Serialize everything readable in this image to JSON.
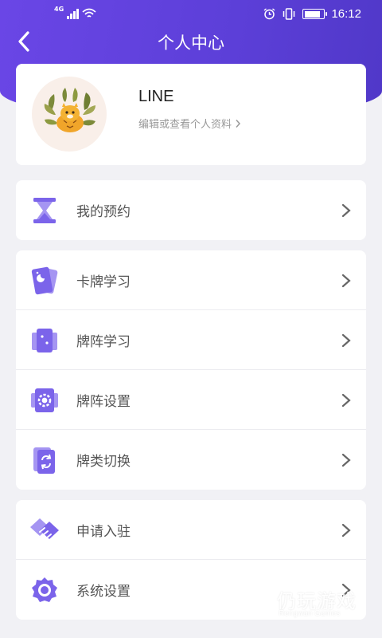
{
  "status_bar": {
    "network": "4G",
    "time": "16:12",
    "battery_level": 0.85,
    "icons": [
      "signal-icon",
      "wifi-icon",
      "alarm-icon",
      "vibrate-icon",
      "battery-icon"
    ]
  },
  "nav": {
    "title": "个人中心",
    "back_icon": "back-arrow-icon"
  },
  "profile": {
    "name": "LINE",
    "subtitle": "编辑或查看个人资料",
    "avatar_icon": "tiger-avatar-icon"
  },
  "groups": [
    {
      "items": [
        {
          "label": "我的预约",
          "icon": "hourglass-icon"
        }
      ]
    },
    {
      "items": [
        {
          "label": "卡牌学习",
          "icon": "card-moon-icon"
        },
        {
          "label": "牌阵学习",
          "icon": "card-spread-icon"
        },
        {
          "label": "牌阵设置",
          "icon": "card-gear-icon"
        },
        {
          "label": "牌类切换",
          "icon": "card-switch-icon"
        }
      ]
    },
    {
      "items": [
        {
          "label": "申请入驻",
          "icon": "handshake-icon"
        },
        {
          "label": "系统设置",
          "icon": "gear-icon"
        }
      ]
    }
  ],
  "watermark": {
    "title": "仍玩游戏",
    "subtitle": "Rengwan Games"
  },
  "colors": {
    "primary": "#6a46e6",
    "icon_purple": "#7b64ea",
    "icon_light": "#a595f2",
    "background": "#f1f1f5",
    "chevron": "#666666"
  }
}
